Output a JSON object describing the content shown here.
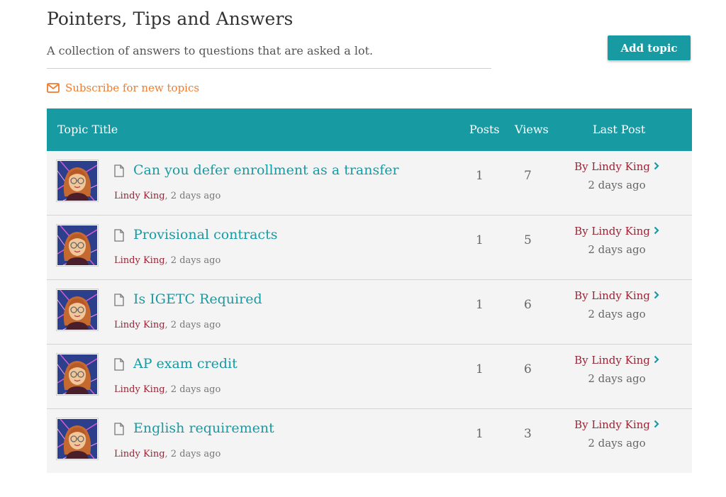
{
  "forum": {
    "title": "Pointers, Tips and Answers",
    "description": "A collection of answers to questions that are asked a lot.",
    "subscribe_label": "Subscribe for new topics",
    "add_topic_label": "Add topic"
  },
  "table": {
    "headers": {
      "title": "Topic Title",
      "posts": "Posts",
      "views": "Views",
      "last_post": "Last Post"
    },
    "topics": [
      {
        "title": "Can you defer enrollment as a transfer",
        "author": "Lindy King",
        "time": ", 2 days ago",
        "posts": "1",
        "views": "7",
        "last_by": "By Lindy King",
        "last_time": "2 days ago"
      },
      {
        "title": "Provisional contracts",
        "author": "Lindy King",
        "time": ", 2 days ago",
        "posts": "1",
        "views": "5",
        "last_by": "By Lindy King",
        "last_time": "2 days ago"
      },
      {
        "title": "Is IGETC Required",
        "author": "Lindy King",
        "time": ", 2 days ago",
        "posts": "1",
        "views": "6",
        "last_by": "By Lindy King",
        "last_time": "2 days ago"
      },
      {
        "title": "AP exam credit",
        "author": "Lindy King",
        "time": ", 2 days ago",
        "posts": "1",
        "views": "6",
        "last_by": "By Lindy King",
        "last_time": "2 days ago"
      },
      {
        "title": "English requirement",
        "author": "Lindy King",
        "time": ", 2 days ago",
        "posts": "1",
        "views": "3",
        "last_by": "By Lindy King",
        "last_time": "2 days ago"
      }
    ]
  },
  "icons": {
    "subscribe": "envelope-icon",
    "topic": "document-icon",
    "last_post_link": "chevron-right-icon",
    "author_avatar": "avatar"
  },
  "colors": {
    "accent": "#189aa3",
    "subscribe": "#ef7c2f",
    "author": "#9b2335",
    "row_background": "#f4f4f4"
  }
}
